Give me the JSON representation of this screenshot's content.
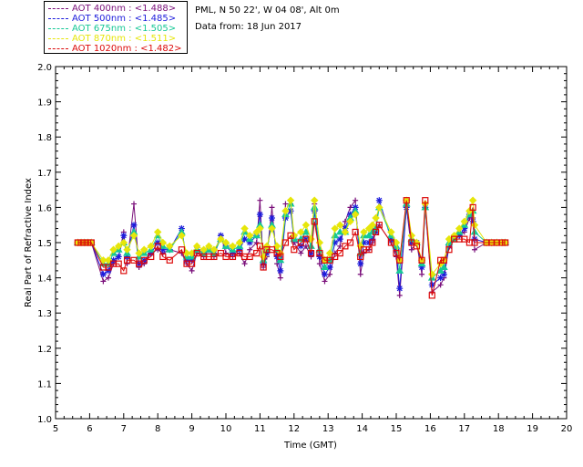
{
  "header": {
    "location": "PML, N 50 22', W 04 08', Alt 0m",
    "date": "Data from: 18 Jun 2017"
  },
  "legend": [
    {
      "label": "AOT  400nm : <1.488>",
      "color": "#7a0f7a"
    },
    {
      "label": "AOT  500nm : <1.485>",
      "color": "#1c1cdc"
    },
    {
      "label": "AOT  675nm : <1.505>",
      "color": "#16c896"
    },
    {
      "label": "AOT  870nm : <1.511>",
      "color": "#e6e60a"
    },
    {
      "label": "AOT 1020nm : <1.482>",
      "color": "#dc0a0a"
    }
  ],
  "chart_data": {
    "type": "line",
    "xlabel": "Time (GMT)",
    "ylabel": "Real Part of Refractive Index",
    "xlim": [
      5,
      20
    ],
    "ylim": [
      1.0,
      2.0
    ],
    "xticks": [
      "5",
      "6",
      "7",
      "8",
      "9",
      "10",
      "11",
      "12",
      "13",
      "14",
      "15",
      "16",
      "17",
      "18",
      "19",
      "20"
    ],
    "yticks": [
      "1.0",
      "1.1",
      "1.2",
      "1.3",
      "1.4",
      "1.5",
      "1.6",
      "1.7",
      "1.8",
      "1.9",
      "2.0"
    ],
    "series": [
      {
        "name": "AOT  400nm",
        "color": "#7a0f7a",
        "marker": "plus",
        "x": [
          5.65,
          5.75,
          5.85,
          5.95,
          6.05,
          6.4,
          6.55,
          6.7,
          6.85,
          7.0,
          7.1,
          7.3,
          7.45,
          7.6,
          7.8,
          8.0,
          8.15,
          8.35,
          8.7,
          8.85,
          9.0,
          9.15,
          9.35,
          9.5,
          9.65,
          9.85,
          10.0,
          10.2,
          10.4,
          10.55,
          10.7,
          10.9,
          11.0,
          11.1,
          11.2,
          11.35,
          11.5,
          11.6,
          11.75,
          11.9,
          12.0,
          12.2,
          12.35,
          12.5,
          12.6,
          12.75,
          12.9,
          13.05,
          13.2,
          13.35,
          13.5,
          13.65,
          13.8,
          13.95,
          14.05,
          14.2,
          14.3,
          14.4,
          14.5,
          14.85,
          15.0,
          15.1,
          15.3,
          15.45,
          15.6,
          15.75,
          15.85,
          16.05,
          16.3,
          16.4,
          16.55,
          16.7,
          16.85,
          17.0,
          17.15,
          17.25,
          17.3,
          17.65,
          17.8,
          17.95,
          18.1,
          18.2
        ],
        "y": [
          1.5,
          1.5,
          1.5,
          1.5,
          1.5,
          1.39,
          1.4,
          1.44,
          1.46,
          1.53,
          1.44,
          1.61,
          1.43,
          1.44,
          1.47,
          1.48,
          1.47,
          1.48,
          1.47,
          1.44,
          1.42,
          1.47,
          1.46,
          1.48,
          1.46,
          1.52,
          1.47,
          1.46,
          1.47,
          1.44,
          1.48,
          1.5,
          1.62,
          1.43,
          1.46,
          1.6,
          1.44,
          1.4,
          1.61,
          1.61,
          1.5,
          1.47,
          1.49,
          1.46,
          1.61,
          1.44,
          1.39,
          1.41,
          1.47,
          1.49,
          1.56,
          1.6,
          1.62,
          1.41,
          1.47,
          1.48,
          1.5,
          1.54,
          1.55,
          1.5,
          1.46,
          1.35,
          1.6,
          1.48,
          1.5,
          1.41,
          1.6,
          1.36,
          1.38,
          1.4,
          1.49,
          1.51,
          1.52,
          1.53,
          1.57,
          1.57,
          1.48,
          1.5,
          1.5,
          1.5,
          1.5,
          1.5
        ]
      },
      {
        "name": "AOT  500nm",
        "color": "#1c1cdc",
        "marker": "star",
        "x": [
          5.65,
          5.75,
          5.85,
          5.95,
          6.05,
          6.4,
          6.55,
          6.7,
          6.85,
          7.0,
          7.1,
          7.3,
          7.45,
          7.6,
          7.8,
          8.0,
          8.15,
          8.35,
          8.7,
          8.85,
          9.0,
          9.15,
          9.35,
          9.5,
          9.65,
          9.85,
          10.0,
          10.2,
          10.4,
          10.55,
          10.7,
          10.9,
          11.0,
          11.1,
          11.2,
          11.35,
          11.5,
          11.6,
          11.75,
          11.9,
          12.0,
          12.2,
          12.35,
          12.5,
          12.6,
          12.75,
          12.9,
          13.05,
          13.2,
          13.35,
          13.5,
          13.65,
          13.8,
          13.95,
          14.05,
          14.2,
          14.3,
          14.4,
          14.5,
          14.85,
          15.0,
          15.1,
          15.3,
          15.45,
          15.6,
          15.75,
          15.85,
          16.05,
          16.3,
          16.4,
          16.55,
          16.7,
          16.85,
          17.0,
          17.15,
          17.25,
          17.3,
          17.65,
          17.8,
          17.95,
          18.1,
          18.2
        ],
        "y": [
          1.5,
          1.5,
          1.5,
          1.5,
          1.5,
          1.41,
          1.42,
          1.45,
          1.46,
          1.52,
          1.46,
          1.55,
          1.44,
          1.45,
          1.47,
          1.5,
          1.48,
          1.48,
          1.54,
          1.45,
          1.45,
          1.48,
          1.47,
          1.48,
          1.47,
          1.52,
          1.49,
          1.47,
          1.48,
          1.51,
          1.5,
          1.52,
          1.58,
          1.44,
          1.47,
          1.57,
          1.46,
          1.42,
          1.57,
          1.59,
          1.51,
          1.49,
          1.51,
          1.47,
          1.59,
          1.46,
          1.41,
          1.43,
          1.5,
          1.51,
          1.54,
          1.58,
          1.6,
          1.44,
          1.5,
          1.5,
          1.51,
          1.53,
          1.62,
          1.51,
          1.48,
          1.37,
          1.6,
          1.5,
          1.5,
          1.43,
          1.6,
          1.38,
          1.4,
          1.41,
          1.49,
          1.51,
          1.52,
          1.54,
          1.58,
          1.56,
          1.51,
          1.5,
          1.5,
          1.5,
          1.5,
          1.5
        ]
      },
      {
        "name": "AOT  675nm",
        "color": "#16c896",
        "marker": "triangle",
        "x": [
          5.65,
          5.75,
          5.85,
          5.95,
          6.05,
          6.4,
          6.55,
          6.7,
          6.85,
          7.0,
          7.1,
          7.3,
          7.45,
          7.6,
          7.8,
          8.0,
          8.15,
          8.35,
          8.7,
          8.85,
          9.0,
          9.15,
          9.35,
          9.5,
          9.65,
          9.85,
          10.0,
          10.2,
          10.4,
          10.55,
          10.7,
          10.9,
          11.0,
          11.1,
          11.2,
          11.35,
          11.5,
          11.6,
          11.75,
          11.9,
          12.0,
          12.2,
          12.35,
          12.5,
          12.6,
          12.75,
          12.9,
          13.05,
          13.2,
          13.35,
          13.5,
          13.65,
          13.8,
          13.95,
          14.05,
          14.2,
          14.3,
          14.4,
          14.5,
          14.85,
          15.0,
          15.1,
          15.3,
          15.45,
          15.6,
          15.75,
          15.85,
          16.05,
          16.3,
          16.4,
          16.55,
          16.7,
          16.85,
          17.0,
          17.15,
          17.25,
          17.3,
          17.65,
          17.8,
          17.95,
          18.1,
          18.2
        ],
        "y": [
          1.5,
          1.5,
          1.5,
          1.5,
          1.5,
          1.44,
          1.44,
          1.47,
          1.48,
          1.5,
          1.47,
          1.53,
          1.46,
          1.47,
          1.48,
          1.52,
          1.49,
          1.48,
          1.53,
          1.46,
          1.46,
          1.48,
          1.47,
          1.48,
          1.47,
          1.51,
          1.49,
          1.48,
          1.49,
          1.53,
          1.51,
          1.52,
          1.55,
          1.45,
          1.48,
          1.55,
          1.48,
          1.45,
          1.58,
          1.61,
          1.51,
          1.51,
          1.53,
          1.49,
          1.6,
          1.48,
          1.43,
          1.45,
          1.52,
          1.53,
          1.53,
          1.57,
          1.59,
          1.47,
          1.52,
          1.52,
          1.53,
          1.54,
          1.6,
          1.52,
          1.49,
          1.42,
          1.61,
          1.51,
          1.5,
          1.44,
          1.6,
          1.4,
          1.42,
          1.43,
          1.5,
          1.51,
          1.53,
          1.55,
          1.58,
          1.59,
          1.53,
          1.5,
          1.5,
          1.5,
          1.5,
          1.5
        ]
      },
      {
        "name": "AOT  870nm",
        "color": "#e6e60a",
        "marker": "diamond",
        "x": [
          5.65,
          5.75,
          5.85,
          5.95,
          6.05,
          6.4,
          6.55,
          6.7,
          6.85,
          7.0,
          7.1,
          7.3,
          7.45,
          7.6,
          7.8,
          8.0,
          8.15,
          8.35,
          8.7,
          8.85,
          9.0,
          9.15,
          9.35,
          9.5,
          9.65,
          9.85,
          10.0,
          10.2,
          10.4,
          10.55,
          10.7,
          10.9,
          11.0,
          11.1,
          11.2,
          11.35,
          11.5,
          11.6,
          11.75,
          11.9,
          12.0,
          12.2,
          12.35,
          12.5,
          12.6,
          12.75,
          12.9,
          13.05,
          13.2,
          13.35,
          13.5,
          13.65,
          13.8,
          13.95,
          14.05,
          14.2,
          14.3,
          14.4,
          14.5,
          14.85,
          15.0,
          15.1,
          15.3,
          15.45,
          15.6,
          15.75,
          15.85,
          16.05,
          16.3,
          16.4,
          16.55,
          16.7,
          16.85,
          17.0,
          17.15,
          17.25,
          17.3,
          17.65,
          17.8,
          17.95,
          18.1,
          18.2
        ],
        "y": [
          1.5,
          1.5,
          1.5,
          1.5,
          1.5,
          1.45,
          1.45,
          1.48,
          1.49,
          1.5,
          1.48,
          1.52,
          1.47,
          1.48,
          1.49,
          1.53,
          1.5,
          1.49,
          1.52,
          1.47,
          1.47,
          1.49,
          1.48,
          1.49,
          1.48,
          1.51,
          1.5,
          1.49,
          1.5,
          1.54,
          1.52,
          1.53,
          1.54,
          1.46,
          1.49,
          1.54,
          1.49,
          1.47,
          1.59,
          1.62,
          1.52,
          1.53,
          1.55,
          1.51,
          1.62,
          1.5,
          1.45,
          1.47,
          1.54,
          1.55,
          1.53,
          1.56,
          1.58,
          1.49,
          1.53,
          1.54,
          1.55,
          1.57,
          1.6,
          1.53,
          1.5,
          1.45,
          1.62,
          1.52,
          1.5,
          1.45,
          1.61,
          1.41,
          1.44,
          1.45,
          1.51,
          1.52,
          1.54,
          1.56,
          1.59,
          1.62,
          1.55,
          1.5,
          1.5,
          1.5,
          1.5,
          1.5
        ]
      },
      {
        "name": "AOT 1020nm",
        "color": "#dc0a0a",
        "marker": "square",
        "x": [
          5.65,
          5.75,
          5.85,
          5.95,
          6.05,
          6.4,
          6.55,
          6.7,
          6.85,
          7.0,
          7.1,
          7.3,
          7.45,
          7.6,
          7.8,
          8.0,
          8.15,
          8.35,
          8.7,
          8.85,
          9.0,
          9.15,
          9.35,
          9.5,
          9.65,
          9.85,
          10.0,
          10.2,
          10.4,
          10.55,
          10.7,
          10.9,
          11.0,
          11.1,
          11.2,
          11.35,
          11.5,
          11.6,
          11.75,
          11.9,
          12.0,
          12.2,
          12.35,
          12.5,
          12.6,
          12.75,
          12.9,
          13.05,
          13.2,
          13.35,
          13.5,
          13.65,
          13.8,
          13.95,
          14.05,
          14.2,
          14.3,
          14.4,
          14.5,
          14.85,
          15.0,
          15.1,
          15.3,
          15.45,
          15.6,
          15.75,
          15.85,
          16.05,
          16.3,
          16.4,
          16.55,
          16.7,
          16.85,
          17.0,
          17.15,
          17.25,
          17.3,
          17.65,
          17.8,
          17.95,
          18.1,
          18.2
        ],
        "y": [
          1.5,
          1.5,
          1.5,
          1.5,
          1.5,
          1.43,
          1.43,
          1.44,
          1.44,
          1.42,
          1.45,
          1.45,
          1.44,
          1.45,
          1.46,
          1.49,
          1.46,
          1.45,
          1.48,
          1.44,
          1.44,
          1.47,
          1.46,
          1.46,
          1.46,
          1.47,
          1.46,
          1.46,
          1.47,
          1.46,
          1.46,
          1.47,
          1.49,
          1.43,
          1.48,
          1.48,
          1.47,
          1.46,
          1.5,
          1.52,
          1.48,
          1.5,
          1.51,
          1.47,
          1.56,
          1.47,
          1.45,
          1.45,
          1.46,
          1.47,
          1.49,
          1.5,
          1.53,
          1.46,
          1.48,
          1.48,
          1.5,
          1.53,
          1.55,
          1.5,
          1.47,
          1.45,
          1.62,
          1.5,
          1.49,
          1.45,
          1.62,
          1.35,
          1.45,
          1.45,
          1.48,
          1.51,
          1.51,
          1.51,
          1.5,
          1.6,
          1.5,
          1.5,
          1.5,
          1.5,
          1.5,
          1.5
        ]
      }
    ]
  }
}
